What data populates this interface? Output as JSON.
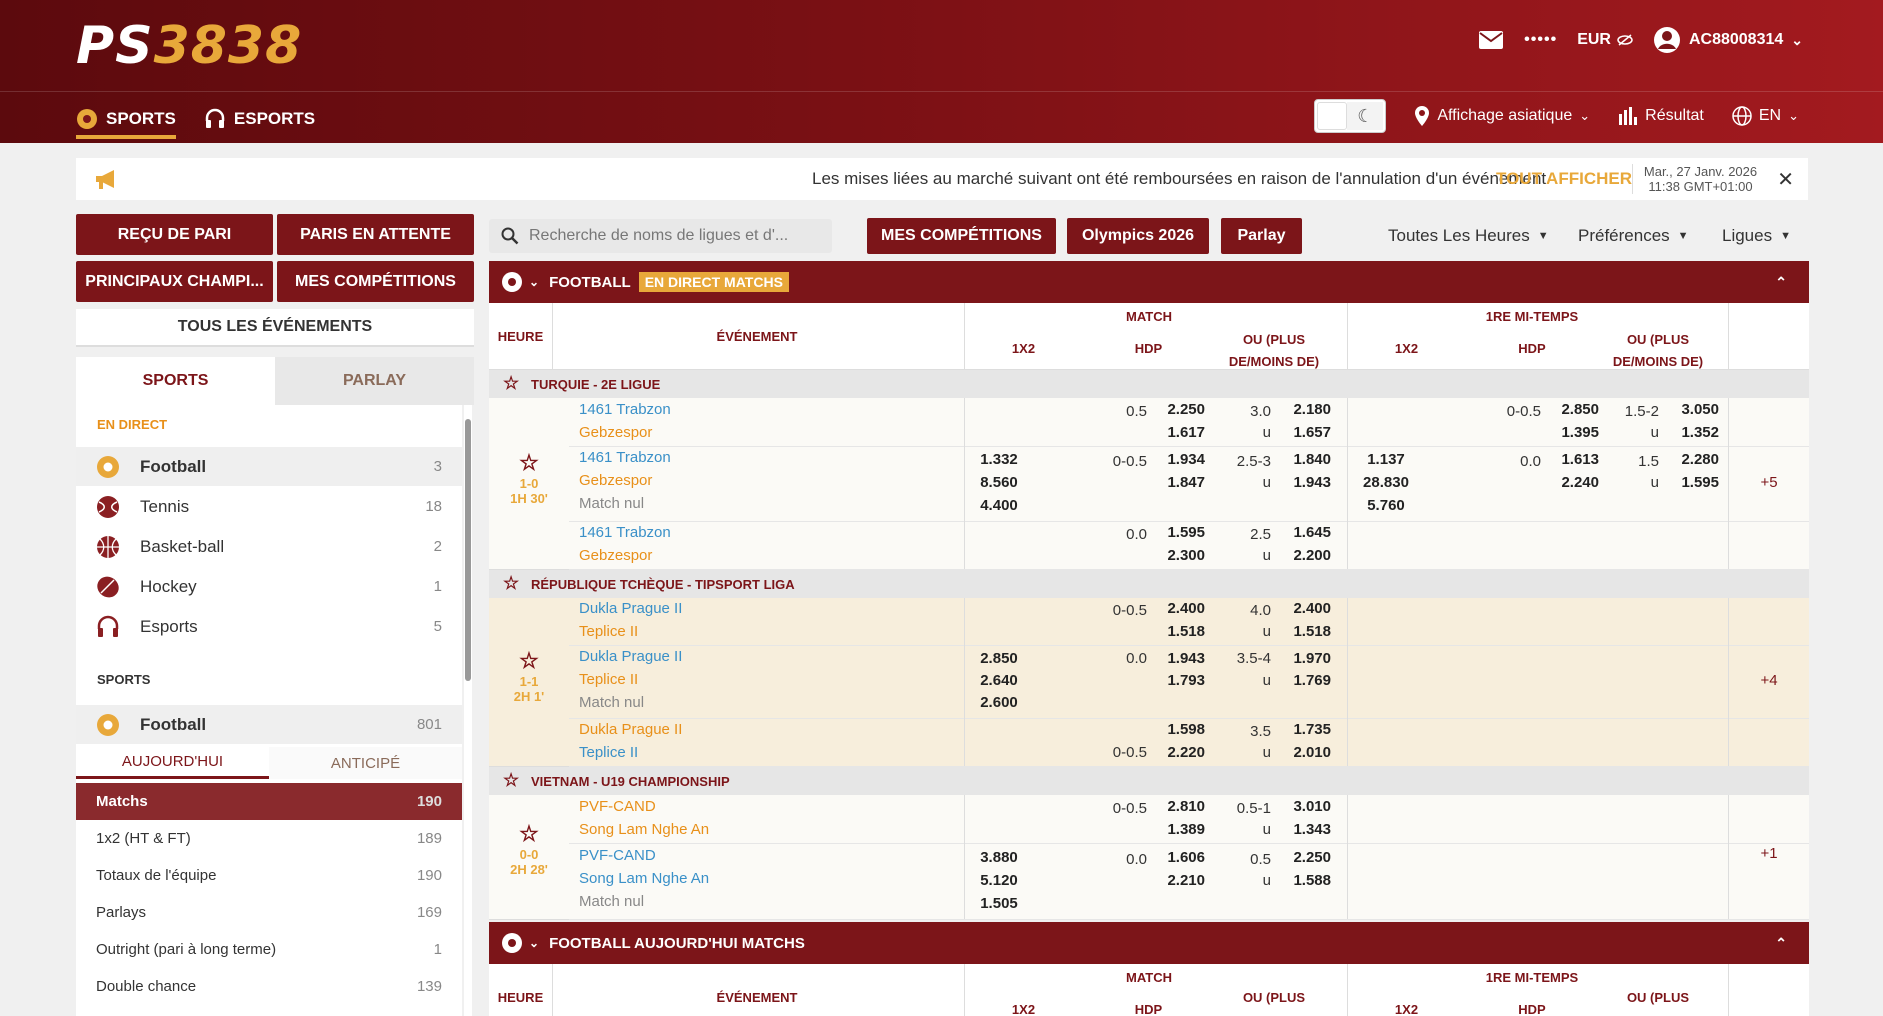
{
  "header": {
    "logo_a": "PS",
    "logo_b": "3838",
    "currency_mask": "•••••",
    "currency": "EUR",
    "account": "AC88008314"
  },
  "nav": {
    "sports": "SPORTS",
    "esports": "ESPORTS",
    "view": "Affichage asiatique",
    "results": "Résultat",
    "lang": "EN"
  },
  "ticker": {
    "message": "Les mises liées au marché suivant ont été remboursées en raison de l'annulation d'un événement",
    "show_all": "TOUT AFFICHER",
    "date": "Mar., 27 Janv. 2026",
    "time": "11:38 GMT+01:00"
  },
  "left_buttons": {
    "receipt": "REÇU DE PARI",
    "pending": "PARIS EN ATTENTE",
    "main_champ": "PRINCIPAUX CHAMPI...",
    "my_comp": "MES COMPÉTITIONS",
    "all_events": "TOUS LES ÉVÉNEMENTS"
  },
  "side_tabs": {
    "sports": "SPORTS",
    "parlay": "PARLAY"
  },
  "live": {
    "title": "EN DIRECT",
    "items": [
      {
        "name": "Football",
        "count": "3"
      },
      {
        "name": "Tennis",
        "count": "18"
      },
      {
        "name": "Basket-ball",
        "count": "2"
      },
      {
        "name": "Hockey",
        "count": "1"
      },
      {
        "name": "Esports",
        "count": "5"
      }
    ]
  },
  "sports": {
    "title": "SPORTS",
    "football": "Football",
    "football_count": "801",
    "today": "AUJOURD'HUI",
    "early": "ANTICIPÉ",
    "markets": [
      {
        "name": "Matchs",
        "count": "190"
      },
      {
        "name": "1x2 (HT & FT)",
        "count": "189"
      },
      {
        "name": "Totaux de l'équipe",
        "count": "190"
      },
      {
        "name": "Parlays",
        "count": "169"
      },
      {
        "name": "Outright (pari à long terme)",
        "count": "1"
      },
      {
        "name": "Double chance",
        "count": "139"
      }
    ]
  },
  "toolbar": {
    "search_placeholder": "Recherche de noms de ligues et d'...",
    "my_comp": "MES COMPÉTITIONS",
    "olympics": "Olympics 2026",
    "parlay": "Parlay",
    "hours": "Toutes Les Heures",
    "prefs": "Préférences",
    "leagues": "Ligues"
  },
  "panel1": {
    "sport": "FOOTBALL",
    "badge": "EN DIRECT MATCHS"
  },
  "panel2": {
    "title": "FOOTBALL AUJOURD'HUI MATCHS"
  },
  "cols": {
    "time": "HEURE",
    "event": "ÉVÉNEMENT",
    "match": "MATCH",
    "half": "1RE MI-TEMPS",
    "x12": "1X2",
    "hdp": "HDP",
    "ou": "OU (PLUS DE/MOINS DE)",
    "ou_short": "OU (PLUS"
  },
  "leagues": [
    {
      "name": "TURQUIE - 2E LIGUE",
      "score": "1-0",
      "clock": "1H 30'",
      "more": "+5",
      "home": "1461 Trabzon",
      "away": "Gebzespor",
      "draw": "Match nul"
    },
    {
      "name": "RÉPUBLIQUE TCHÈQUE - TIPSPORT LIGA",
      "score": "1-1",
      "clock": "2H 1'",
      "more": "+4",
      "home": "Dukla Prague II",
      "away": "Teplice II",
      "draw": "Match nul"
    },
    {
      "name": "VIETNAM - U19 CHAMPIONSHIP",
      "score": "0-0",
      "clock": "2H 28'",
      "more": "+1",
      "home": "PVF-CAND",
      "away": "Song Lam Nghe An",
      "draw": "Match nul"
    }
  ],
  "odds": {
    "l1r1": {
      "hdp": "0.5",
      "h1": "2.250",
      "h2": "1.617",
      "ou": "3.0",
      "o1": "2.180",
      "u": "u",
      "o2": "1.657",
      "hhdp": "0-0.5",
      "hh1": "2.850",
      "hh2": "1.395",
      "hou": "1.5-2",
      "ho1": "3.050",
      "ho2": "1.352"
    },
    "l1r2": {
      "x1": "1.332",
      "x2": "8.560",
      "x3": "4.400",
      "hdp": "0-0.5",
      "h1": "1.934",
      "h2": "1.847",
      "ou": "2.5-3",
      "o1": "1.840",
      "o2": "1.943",
      "hx1": "1.137",
      "hx2": "28.830",
      "hx3": "5.760",
      "hhdp": "0.0",
      "hh1": "1.613",
      "hh2": "2.240",
      "hou": "1.5",
      "ho1": "2.280",
      "ho2": "1.595"
    },
    "l1r3": {
      "hdp": "0.0",
      "h1": "1.595",
      "h2": "2.300",
      "ou": "2.5",
      "o1": "1.645",
      "o2": "2.200"
    },
    "l2r1": {
      "hdp": "0-0.5",
      "h1": "2.400",
      "h2": "1.518",
      "ou": "4.0",
      "o1": "2.400",
      "o2": "1.518"
    },
    "l2r2": {
      "x1": "2.850",
      "x2": "2.640",
      "x3": "2.600",
      "hdp": "0.0",
      "h1": "1.943",
      "h2": "1.793",
      "ou": "3.5-4",
      "o1": "1.970",
      "o2": "1.769"
    },
    "l2r3": {
      "hdp": "0-0.5",
      "h1": "1.598",
      "h2": "2.220",
      "ou": "3.5",
      "o1": "1.735",
      "o2": "2.010"
    },
    "l3r1": {
      "hdp": "0-0.5",
      "h1": "2.810",
      "h2": "1.389",
      "ou": "0.5-1",
      "o1": "3.010",
      "o2": "1.343"
    },
    "l3r2": {
      "x1": "3.880",
      "x2": "5.120",
      "x3": "1.505",
      "hdp": "0.0",
      "h1": "1.606",
      "h2": "2.210",
      "ou": "0.5",
      "o1": "2.250",
      "o2": "1.588"
    }
  }
}
